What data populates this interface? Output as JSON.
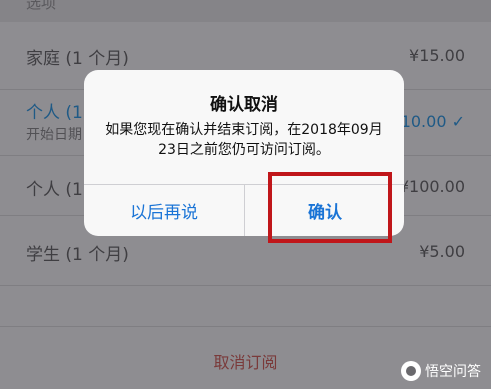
{
  "background": {
    "section_header": "选项",
    "rows": [
      {
        "label": "家庭 (1 个月)",
        "price": "¥15.00"
      },
      {
        "label": "个人 (1",
        "sub": "开始日期",
        "price": "¥10.00 ✓"
      },
      {
        "label": "个人 (1",
        "price": "¥100.00"
      },
      {
        "label": "学生 (1 个月)",
        "price": "¥5.00"
      }
    ],
    "cancel_subscription": "取消订阅"
  },
  "alert": {
    "title": "确认取消",
    "message": "如果您现在确认并结束订阅，在2018年09月23日之前您仍可访问订阅。",
    "buttons": {
      "later": "以后再说",
      "confirm": "确认"
    }
  },
  "watermark": {
    "text": "悟空问答"
  },
  "colors": {
    "accent": "#1a74d6",
    "highlight": "#c0161a",
    "selected_text": "#1f5a86"
  }
}
